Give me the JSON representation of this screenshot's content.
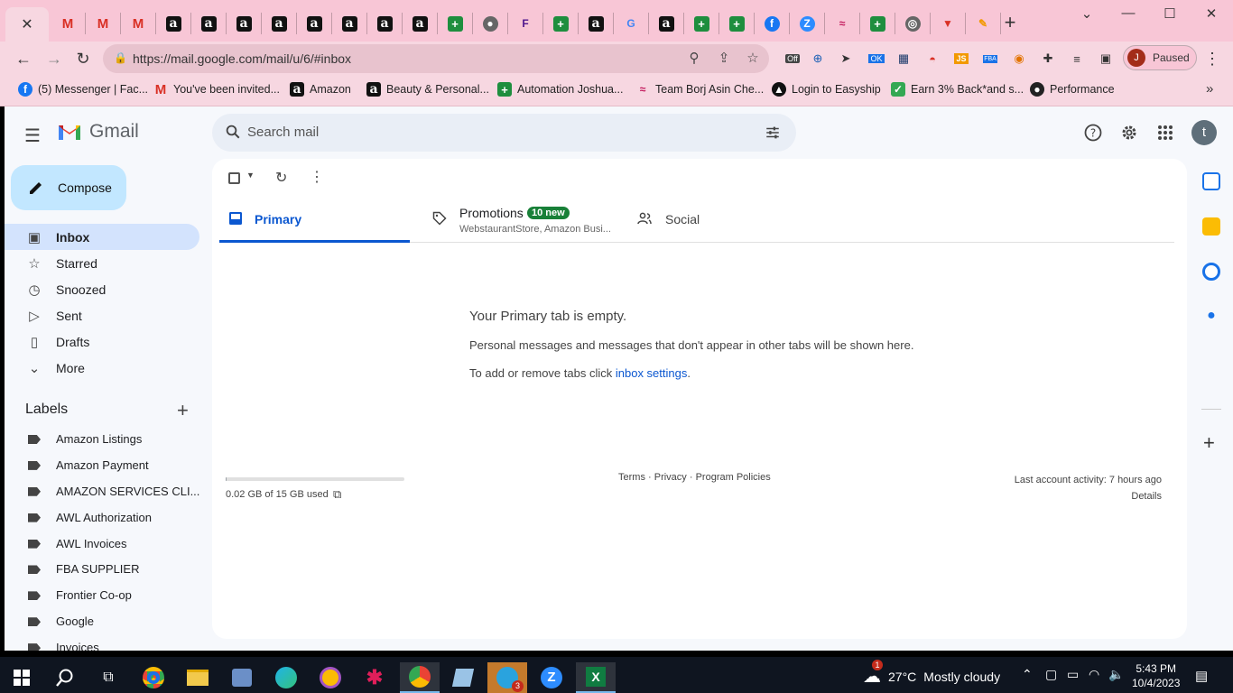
{
  "browser": {
    "tabs": [
      "gmail",
      "gmail",
      "gmail-alt",
      "amazon",
      "amazon",
      "amazon",
      "amazon",
      "amazon",
      "amazon",
      "amazon",
      "amazon-smile",
      "sheets",
      "globe",
      "fedex",
      "sheets",
      "amazon",
      "google",
      "amazon-smile",
      "sheets",
      "sheets",
      "facebook",
      "zoom",
      "app",
      "sheets",
      "chrome",
      "app2",
      "app3"
    ],
    "active_tab_close": "✕",
    "new_tab": "+",
    "url": "https://mail.google.com/mail/u/6/#inbox",
    "profile_initial": "J",
    "profile_status": "Paused",
    "bookmarks": [
      {
        "label": "(5) Messenger | Fac...",
        "icon": "facebook"
      },
      {
        "label": "You've been invited...",
        "icon": "gmail"
      },
      {
        "label": "Amazon",
        "icon": "amazon"
      },
      {
        "label": "Beauty & Personal...",
        "icon": "amazon-smile"
      },
      {
        "label": "Automation Joshua...",
        "icon": "sheets"
      },
      {
        "label": "Team Borj Asin Che...",
        "icon": "app"
      },
      {
        "label": "Login to Easyship",
        "icon": "easyship"
      },
      {
        "label": "Earn 3% Back*and s...",
        "icon": "rakuten"
      },
      {
        "label": "Performance",
        "icon": "globe"
      }
    ],
    "bookmarks_more": "»"
  },
  "gmail": {
    "logo_text": "Gmail",
    "search_placeholder": "Search mail",
    "account_initial": "t",
    "compose_label": "Compose",
    "nav": [
      {
        "label": "Inbox",
        "icon": "inbox-icon",
        "active": true
      },
      {
        "label": "Starred",
        "icon": "star-icon"
      },
      {
        "label": "Snoozed",
        "icon": "clock-icon"
      },
      {
        "label": "Sent",
        "icon": "send-icon"
      },
      {
        "label": "Drafts",
        "icon": "draft-icon"
      },
      {
        "label": "More",
        "icon": "chevron-down-icon"
      }
    ],
    "labels_title": "Labels",
    "labels": [
      "Amazon Listings",
      "Amazon Payment",
      "AMAZON SERVICES CLI...",
      "AWL Authorization",
      "AWL Invoices",
      "FBA SUPPLIER",
      "Frontier Co-op",
      "Google",
      "Invoices"
    ],
    "tabs": {
      "primary": "Primary",
      "promotions": "Promotions",
      "promotions_badge": "10 new",
      "promotions_senders": "WebstaurantStore, Amazon Busi...",
      "social": "Social"
    },
    "empty": {
      "title": "Your Primary tab is empty.",
      "description": "Personal messages and messages that don't appear in other tabs will be shown here.",
      "hint_prefix": "To add or remove tabs click ",
      "hint_link": "inbox settings",
      "hint_suffix": "."
    },
    "storage": {
      "text": "0.02 GB of 15 GB used",
      "used_fraction": 0.0013
    },
    "footer": {
      "terms": "Terms",
      "privacy": "Privacy",
      "policies": "Program Policies",
      "separator": " · "
    },
    "activity": {
      "text": "Last account activity: 7 hours ago",
      "details": "Details"
    }
  },
  "taskbar": {
    "weather_temp": "27°C",
    "weather_desc": "Mostly cloudy",
    "weather_badge": "1",
    "time": "5:43 PM",
    "date": "10/4/2023",
    "telegram_badge": "3"
  }
}
